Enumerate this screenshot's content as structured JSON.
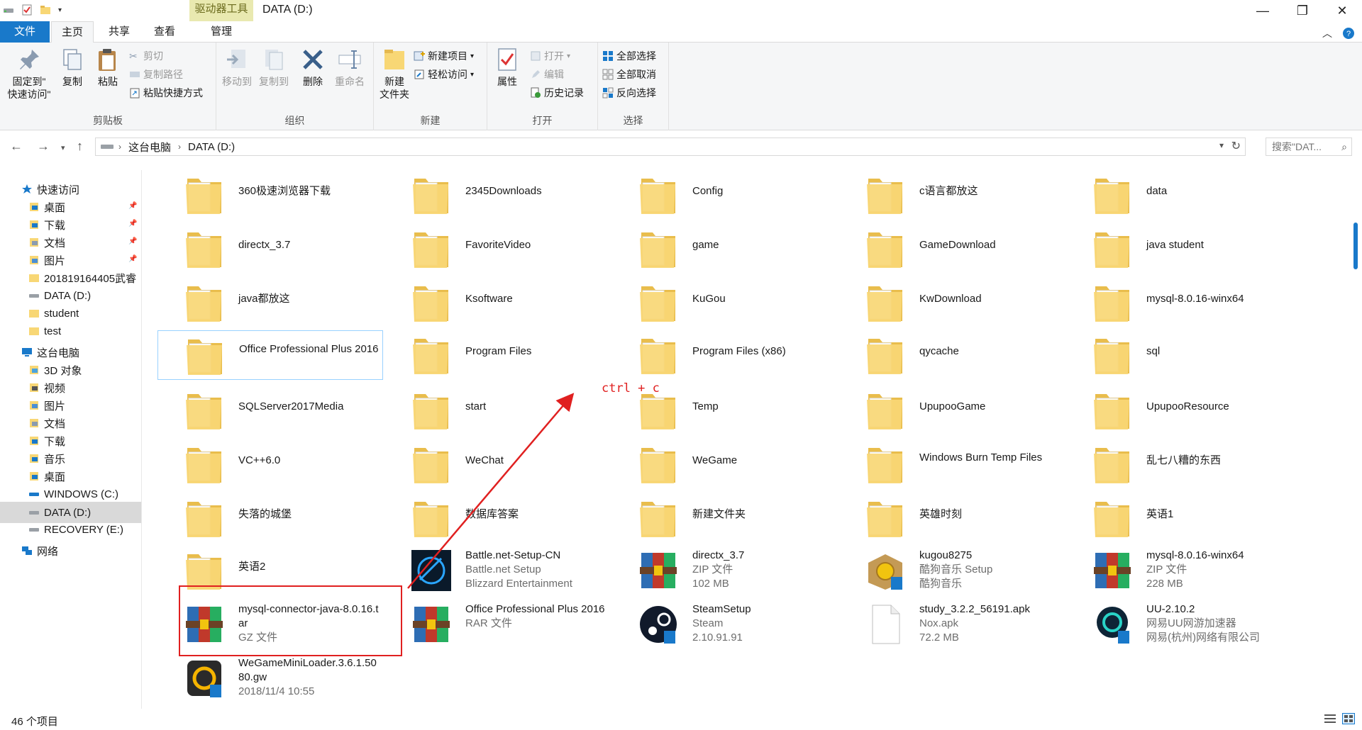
{
  "window": {
    "title": "DATA (D:)",
    "context_group": "驱动器工具"
  },
  "tabs": {
    "file": "文件",
    "home": "主页",
    "share": "共享",
    "view": "查看",
    "manage": "管理"
  },
  "ribbon": {
    "clipboard": {
      "label": "剪贴板",
      "pin": "固定到\"\n快速访问\"",
      "copy": "复制",
      "paste": "粘贴",
      "cut": "剪切",
      "copy_path": "复制路径",
      "paste_shortcut": "粘贴快捷方式"
    },
    "organize": {
      "label": "组织",
      "move_to": "移动到",
      "copy_to": "复制到",
      "delete": "删除",
      "rename": "重命名"
    },
    "new": {
      "label": "新建",
      "new_folder": "新建\n文件夹",
      "new_item": "新建项目",
      "easy_access": "轻松访问"
    },
    "open": {
      "label": "打开",
      "properties": "属性",
      "open": "打开",
      "edit": "编辑",
      "history": "历史记录"
    },
    "select": {
      "label": "选择",
      "select_all": "全部选择",
      "select_none": "全部取消",
      "invert": "反向选择"
    }
  },
  "address": {
    "segments": [
      "这台电脑",
      "DATA (D:)"
    ],
    "search_placeholder": "搜索\"DAT..."
  },
  "nav": [
    {
      "label": "快速访问",
      "icon": "star-icon",
      "pinned": false
    },
    {
      "label": "桌面",
      "icon": "desktop-icon",
      "pinned": true
    },
    {
      "label": "下载",
      "icon": "download-icon",
      "pinned": true
    },
    {
      "label": "文档",
      "icon": "document-icon",
      "pinned": true
    },
    {
      "label": "图片",
      "icon": "picture-icon",
      "pinned": true
    },
    {
      "label": "201819164405武睿",
      "icon": "folder-icon",
      "pinned": false
    },
    {
      "label": "DATA (D:)",
      "icon": "drive-icon",
      "pinned": false
    },
    {
      "label": "student",
      "icon": "folder-icon",
      "pinned": false
    },
    {
      "label": "test",
      "icon": "folder-icon",
      "pinned": false
    },
    {
      "label": "这台电脑",
      "icon": "computer-icon",
      "pinned": false
    },
    {
      "label": "3D 对象",
      "icon": "3d-objects-icon",
      "pinned": false
    },
    {
      "label": "视频",
      "icon": "video-icon",
      "pinned": false
    },
    {
      "label": "图片",
      "icon": "picture-icon",
      "pinned": false
    },
    {
      "label": "文档",
      "icon": "document-icon",
      "pinned": false
    },
    {
      "label": "下载",
      "icon": "download-icon",
      "pinned": false
    },
    {
      "label": "音乐",
      "icon": "music-icon",
      "pinned": false
    },
    {
      "label": "桌面",
      "icon": "desktop-icon",
      "pinned": false
    },
    {
      "label": "WINDOWS (C:)",
      "icon": "windows-drive-icon",
      "pinned": false
    },
    {
      "label": "DATA (D:)",
      "icon": "drive-icon",
      "pinned": false
    },
    {
      "label": "RECOVERY (E:)",
      "icon": "drive-icon",
      "pinned": false
    },
    {
      "label": "网络",
      "icon": "network-icon",
      "pinned": false
    }
  ],
  "files": [
    {
      "name": "360极速浏览器下载",
      "icon": "folder-icon"
    },
    {
      "name": "2345Downloads",
      "icon": "folder-icon"
    },
    {
      "name": "Config",
      "icon": "folder-icon"
    },
    {
      "name": "c语言都放这",
      "icon": "folder-icon"
    },
    {
      "name": "data",
      "icon": "folder-icon"
    },
    {
      "name": "directx_3.7",
      "icon": "folder-icon"
    },
    {
      "name": "FavoriteVideo",
      "icon": "folder-icon"
    },
    {
      "name": "game",
      "icon": "folder-icon"
    },
    {
      "name": "GameDownload",
      "icon": "folder-icon"
    },
    {
      "name": "java student",
      "icon": "folder-icon"
    },
    {
      "name": "java都放这",
      "icon": "folder-icon"
    },
    {
      "name": "Ksoftware",
      "icon": "folder-icon"
    },
    {
      "name": "KuGou",
      "icon": "folder-icon"
    },
    {
      "name": "KwDownload",
      "icon": "folder-icon"
    },
    {
      "name": "mysql-8.0.16-winx64",
      "icon": "folder-icon"
    },
    {
      "name": "Office Professional Plus 2016",
      "icon": "folder-icon"
    },
    {
      "name": "Program Files",
      "icon": "folder-icon"
    },
    {
      "name": "Program Files (x86)",
      "icon": "folder-icon"
    },
    {
      "name": "qycache",
      "icon": "folder-icon"
    },
    {
      "name": "sql",
      "icon": "folder-icon"
    },
    {
      "name": "SQLServer2017Media",
      "icon": "folder-icon"
    },
    {
      "name": "start",
      "icon": "folder-icon"
    },
    {
      "name": "Temp",
      "icon": "folder-icon"
    },
    {
      "name": "UpupooGame",
      "icon": "folder-icon"
    },
    {
      "name": "UpupooResource",
      "icon": "folder-icon"
    },
    {
      "name": "VC++6.0",
      "icon": "folder-icon"
    },
    {
      "name": "WeChat",
      "icon": "folder-icon"
    },
    {
      "name": "WeGame",
      "icon": "folder-icon"
    },
    {
      "name": "Windows Burn Temp Files",
      "icon": "folder-icon"
    },
    {
      "name": "乱七八糟的东西",
      "icon": "folder-icon"
    },
    {
      "name": "失落的城堡",
      "icon": "folder-icon"
    },
    {
      "name": "数据库答案",
      "icon": "folder-icon"
    },
    {
      "name": "新建文件夹",
      "icon": "folder-icon"
    },
    {
      "name": "英雄时刻",
      "icon": "folder-icon"
    },
    {
      "name": "英语1",
      "icon": "folder-icon"
    },
    {
      "name": "英语2",
      "icon": "folder-icon"
    },
    {
      "name": "Battle.net-Setup-CN",
      "icon": "battlenet-icon",
      "line2": "Battle.net Setup",
      "line3": "Blizzard Entertainment"
    },
    {
      "name": "directx_3.7",
      "icon": "winrar-icon",
      "line2": "ZIP 文件",
      "line3": "102 MB"
    },
    {
      "name": "kugou8275",
      "icon": "kugou-installer-icon",
      "line2": "酷狗音乐 Setup",
      "line3": "酷狗音乐"
    },
    {
      "name": "mysql-8.0.16-winx64",
      "icon": "winrar-icon",
      "line2": "ZIP 文件",
      "line3": "228 MB"
    },
    {
      "name": "mysql-connector-java-8.0.16.tar",
      "icon": "winrar-icon",
      "line2": "GZ 文件",
      "line3": ""
    },
    {
      "name": "Office Professional Plus 2016",
      "icon": "winrar-icon",
      "line2": "RAR 文件",
      "line3": ""
    },
    {
      "name": "SteamSetup",
      "icon": "steam-icon",
      "line2": "Steam",
      "line3": "2.10.91.91"
    },
    {
      "name": "study_3.2.2_56191.apk",
      "icon": "file-icon",
      "line2": "Nox.apk",
      "line3": "72.2 MB"
    },
    {
      "name": "UU-2.10.2",
      "icon": "uu-icon",
      "line2": "网易UU网游加速器",
      "line3": "网易(杭州)网络有限公司"
    },
    {
      "name": "WeGameMiniLoader.3.6.1.5080.gw",
      "icon": "wegame-icon",
      "line2": "2018/11/4 10:55",
      "line3": ""
    }
  ],
  "selected_index": 15,
  "annotation": {
    "text": "ctrl + c",
    "color": "#e02020"
  },
  "status": {
    "count": "46 个项目"
  },
  "colors": {
    "accent": "#1979ca",
    "folder": "#f8d775",
    "selection_border": "#99d1ff"
  }
}
